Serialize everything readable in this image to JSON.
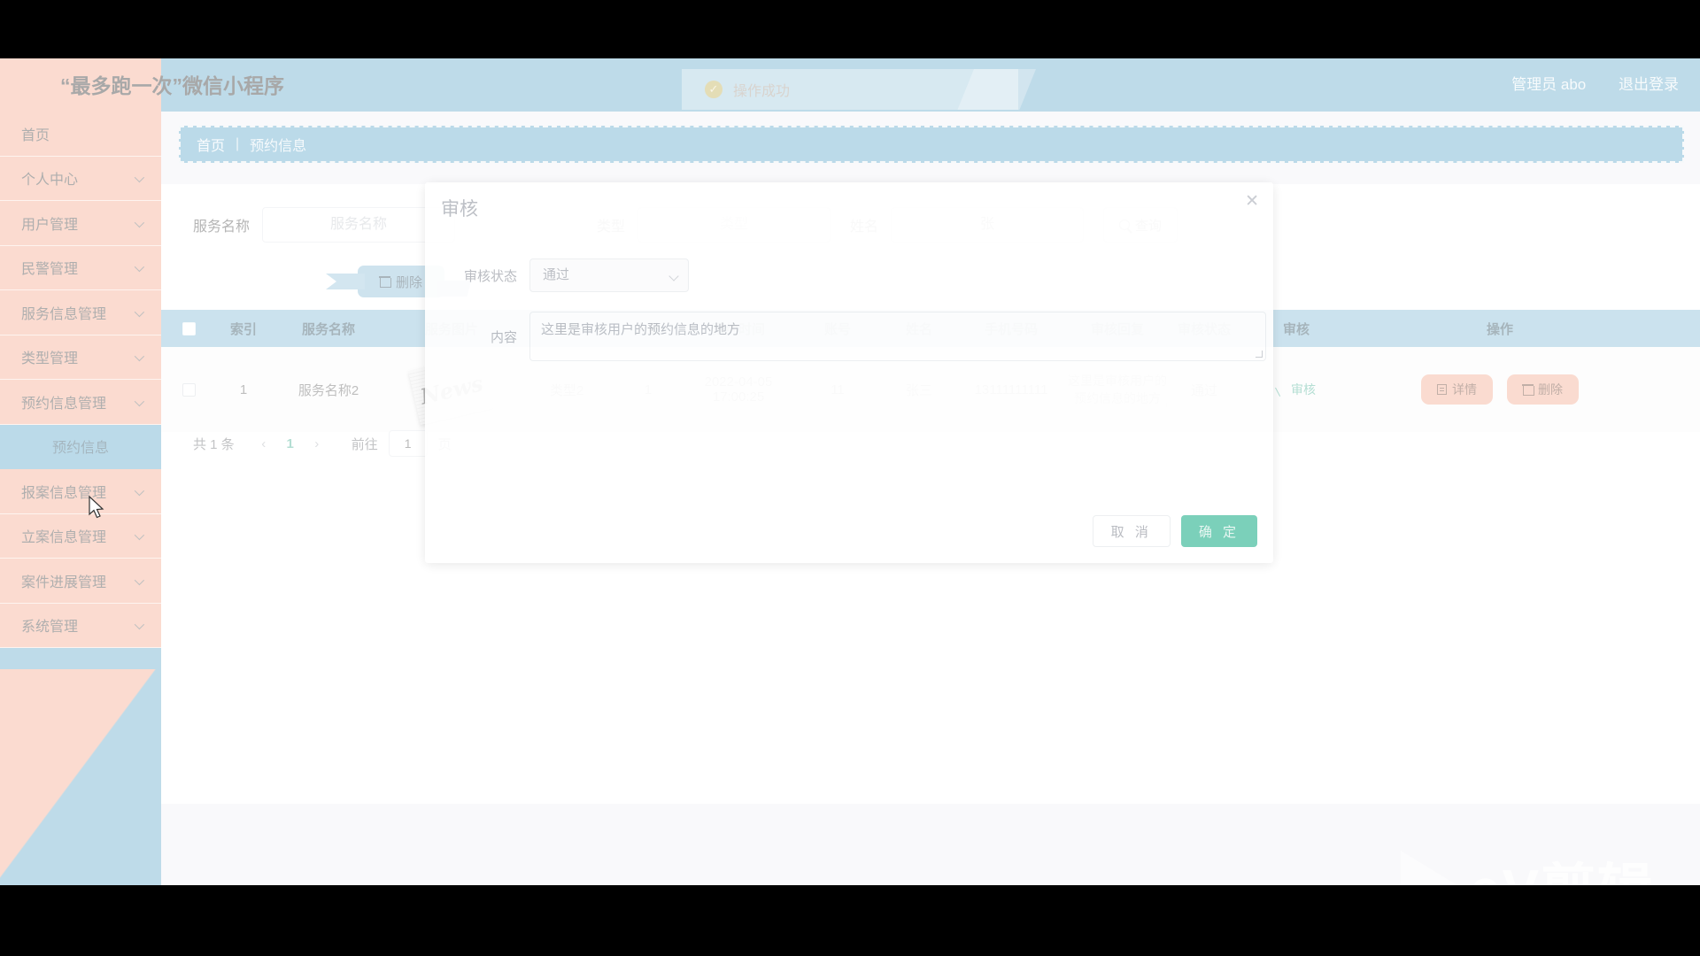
{
  "header": {
    "brand": "“最多跑一次”微信小程序",
    "admin": "管理员 abo",
    "logout": "退出登录"
  },
  "toast": {
    "text": "操作成功",
    "icon": "check-circle-icon",
    "color": "#b9a53f"
  },
  "sidebar": {
    "items": [
      {
        "label": "首页",
        "has_caret": false,
        "active": false
      },
      {
        "label": "个人中心",
        "has_caret": true,
        "active": false
      },
      {
        "label": "用户管理",
        "has_caret": true,
        "active": false
      },
      {
        "label": "民警管理",
        "has_caret": true,
        "active": false
      },
      {
        "label": "服务信息管理",
        "has_caret": true,
        "active": false
      },
      {
        "label": "类型管理",
        "has_caret": true,
        "active": false
      },
      {
        "label": "预约信息管理",
        "has_caret": true,
        "active": false
      },
      {
        "label": "预约信息",
        "has_caret": false,
        "active": true
      },
      {
        "label": "报案信息管理",
        "has_caret": true,
        "active": false
      },
      {
        "label": "立案信息管理",
        "has_caret": true,
        "active": false
      },
      {
        "label": "案件进展管理",
        "has_caret": true,
        "active": false
      },
      {
        "label": "系统管理",
        "has_caret": true,
        "active": false
      }
    ]
  },
  "breadcrumb": {
    "home": "首页",
    "separator": "|",
    "current": "预约信息"
  },
  "search": {
    "service_name_label": "服务名称",
    "service_name_placeholder": "服务名称",
    "service_name_value": "",
    "type_label": "类型",
    "type_placeholder": "类型",
    "type_value": "",
    "name_label": "姓名",
    "name_value": "张",
    "query_button": "查询",
    "query_icon": "search-icon"
  },
  "toolbar": {
    "delete_label": "删除",
    "delete_icon": "trash-icon"
  },
  "table": {
    "columns": [
      "索引",
      "服务名称",
      "服务图片",
      "类型",
      "人数",
      "预约时间",
      "账号",
      "姓名",
      "手机号码",
      "审核回复",
      "审核状态",
      "审核",
      "操作"
    ],
    "rows": [
      {
        "index": "1",
        "service_name": "服务名称2",
        "image_alt": "News",
        "type": "类型2",
        "people": "1",
        "appointment_time": "2022-04-05 17:00:25",
        "account": "11",
        "name": "张三",
        "phone": "13111111111",
        "audit_reply": "这里是审核用户的预约信息的地方",
        "audit_status": "通过",
        "audit_link": "审核",
        "detail_button": "详情",
        "delete_button": "删除"
      }
    ]
  },
  "pagination": {
    "total": "共 1 条",
    "prev": "‹",
    "page": "1",
    "next": "›",
    "goto_label": "前往",
    "goto_value": "1",
    "page_unit": "页"
  },
  "modal": {
    "title": "审核",
    "close_icon": "close-icon",
    "status_label": "审核状态",
    "status_value": "通过",
    "content_label": "内容",
    "content_placeholder": "这里是审核用户的预约信息的地方",
    "cancel": "取 消",
    "confirm": "确 定"
  },
  "watermark": {
    "text": "eV剪辑",
    "icon": "play-icon"
  },
  "colors": {
    "brand_orange": "#f3a183",
    "brand_blue": "#55a0c4",
    "table_header": "#77b3d1",
    "accent_green": "#3aa98c",
    "confirm": "#72cdb5"
  }
}
